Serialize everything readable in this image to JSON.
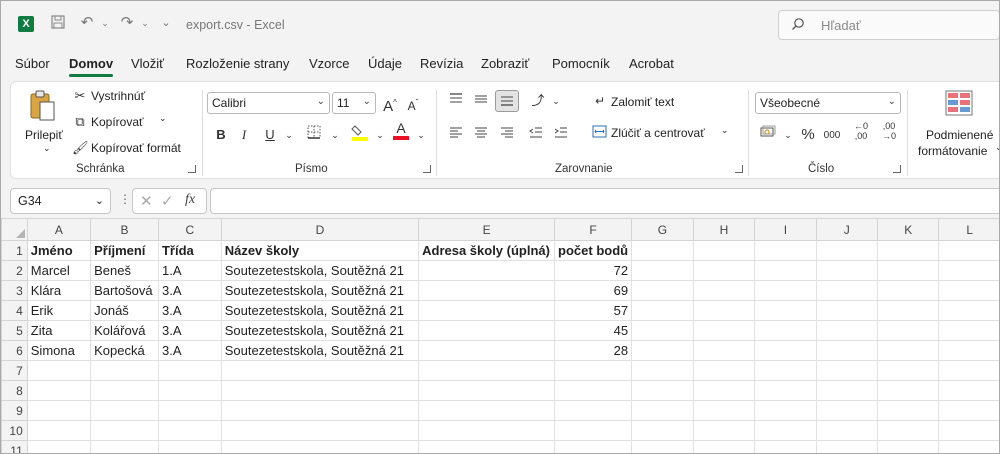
{
  "app": {
    "logo": "X",
    "title": "export.csv  -  Excel",
    "search_placeholder": "Hľadať"
  },
  "menu": {
    "tabs": [
      "Súbor",
      "Domov",
      "Vložiť",
      "Rozloženie strany",
      "Vzorce",
      "Údaje",
      "Revízia",
      "Zobraziť",
      "Pomocník",
      "Acrobat"
    ],
    "active_index": 1
  },
  "ribbon": {
    "clipboard": {
      "paste": "Prilepiť",
      "cut": "Vystrihnúť",
      "copy": "Kopírovať",
      "format_painter": "Kopírovať formát",
      "label": "Schránka"
    },
    "font": {
      "name": "Calibri",
      "size": "11",
      "grow": "A",
      "shrink": "A",
      "bold": "B",
      "italic": "I",
      "underline": "U",
      "font_color_letter": "A",
      "label": "Písmo"
    },
    "alignment": {
      "wrap_text": "Zalomiť text",
      "merge_center": "Zlúčiť a centrovať",
      "label": "Zarovnanie"
    },
    "number": {
      "format": "Všeobecné",
      "percent": "%",
      "thousands": "000",
      "inc_decimal": ",00",
      "dec_decimal": ",00",
      "label": "Číslo"
    },
    "styles": {
      "conditional_line1": "Podmienené",
      "conditional_line2": "formátovanie"
    }
  },
  "formula_bar": {
    "name_box": "G34",
    "fx": "fx",
    "value": ""
  },
  "sheet": {
    "columns": [
      "A",
      "B",
      "C",
      "D",
      "E",
      "F",
      "G",
      "H",
      "I",
      "J",
      "K",
      "L"
    ],
    "row_numbers": [
      "1",
      "2",
      "3",
      "4",
      "5",
      "6",
      "7",
      "8",
      "9",
      "10",
      "11"
    ],
    "header": [
      "Jméno",
      "Příjmení",
      "Třída",
      "Název školy",
      "Adresa školy (úplná)",
      "počet bodů"
    ],
    "rows": [
      [
        "Marcel",
        "Beneš",
        "1.A",
        "Soutezetestskola, Soutěžná 21",
        "",
        "72"
      ],
      [
        "Klára",
        "Bartošová",
        "3.A",
        "Soutezetestskola, Soutěžná 21",
        "",
        "69"
      ],
      [
        "Erik",
        "Jonáš",
        "3.A",
        "Soutezetestskola, Soutěžná 21",
        "",
        "57"
      ],
      [
        "Zita",
        "Kolářová",
        "3.A",
        "Soutezetestskola, Soutěžná 21",
        "",
        "45"
      ],
      [
        "Simona",
        "Kopecká",
        "3.A",
        "Soutezetestskola, Soutěžná 21",
        "",
        "28"
      ]
    ]
  },
  "colors": {
    "accent": "#107c41",
    "highlight_bar": "#ffff00",
    "font_color_bar": "#e81123"
  }
}
